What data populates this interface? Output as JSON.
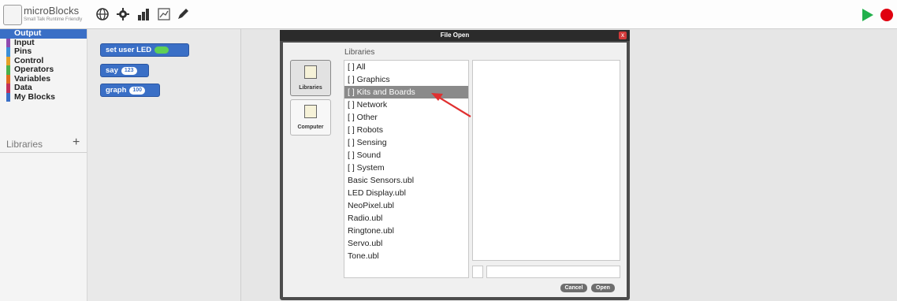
{
  "app": {
    "title": "microBlocks",
    "tagline": "Small Talk Runtime Friendly"
  },
  "toolbar": {
    "icons": [
      "globe-icon",
      "gear-icon",
      "bar-graph-icon",
      "chart-window-icon",
      "pen-icon"
    ],
    "run_color": "#22b14c",
    "stop_color": "#e0000f"
  },
  "sidebar": {
    "categories": [
      {
        "label": "Output",
        "color": "#3a6fc6",
        "selected": true
      },
      {
        "label": "Input",
        "color": "#8f4bb0"
      },
      {
        "label": "Pins",
        "color": "#3c8fd6"
      },
      {
        "label": "Control",
        "color": "#e3a028"
      },
      {
        "label": "Operators",
        "color": "#4bb04b"
      },
      {
        "label": "Variables",
        "color": "#e06b1f"
      },
      {
        "label": "Data",
        "color": "#c2305a"
      },
      {
        "label": "My Blocks",
        "color": "#3a6fc6"
      }
    ],
    "libraries_label": "Libraries",
    "add_label": "+"
  },
  "palette": {
    "blocks": [
      {
        "label": "set user LED",
        "arg": ""
      },
      {
        "label": "say",
        "arg": "123"
      },
      {
        "label": "graph",
        "arg": "100"
      }
    ]
  },
  "dialog": {
    "title": "File Open",
    "close": "x",
    "sources": [
      {
        "label": "Libraries",
        "selected": true
      },
      {
        "label": "Computer",
        "selected": false
      }
    ],
    "list_title": "Libraries",
    "items": [
      "[ ] All",
      "[ ] Graphics",
      "[ ] Kits and Boards",
      "[ ] Network",
      "[ ] Other",
      "[ ] Robots",
      "[ ] Sensing",
      "[ ] Sound",
      "[ ] System",
      "Basic Sensors.ubl",
      "LED Display.ubl",
      "NeoPixel.ubl",
      "Radio.ubl",
      "Ringtone.ubl",
      "Servo.ubl",
      "Tone.ubl"
    ],
    "selected_item": "[ ] Kits and Boards",
    "cancel_label": "Cancel",
    "open_label": "Open",
    "annotation_color": "#e03030"
  }
}
